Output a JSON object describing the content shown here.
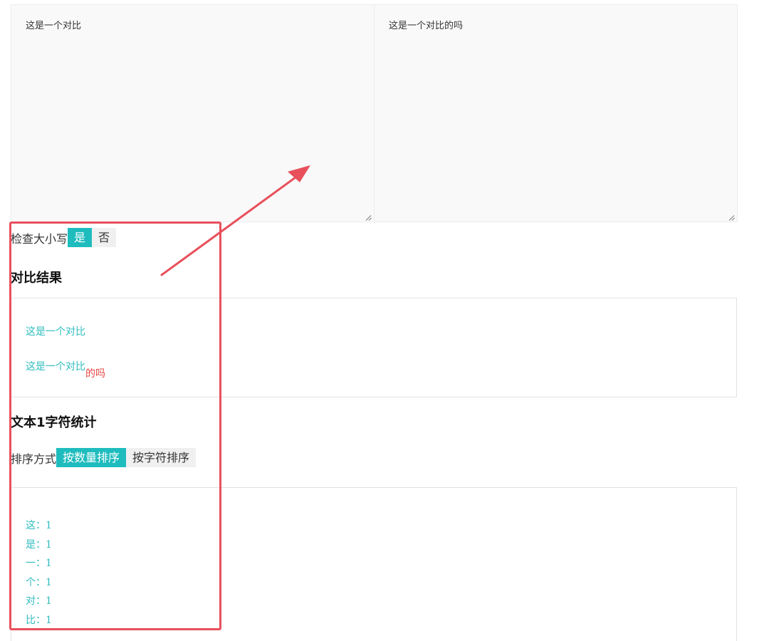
{
  "inputs": {
    "text1": "这是一个对比",
    "text2": "这是一个对比的吗"
  },
  "case_check": {
    "label": "检查大小写",
    "yes": "是",
    "no": "否",
    "selected": "是"
  },
  "result": {
    "heading": "对比结果",
    "line1": "这是一个对比",
    "line2_same": "这是一个对比",
    "line2_added": "的吗"
  },
  "stats": {
    "heading": "文本1字符统计",
    "sort_label": "排序方式",
    "sort_by_count": "按数量排序",
    "sort_by_char": "按字符排序",
    "selected": "按数量排序",
    "items": [
      "这：1",
      "是：1",
      "一：1",
      "个：1",
      "对：1",
      "比：1"
    ]
  },
  "colors": {
    "accent": "#1fbcbe",
    "diff_same": "#2fbcbf",
    "diff_added": "#e5473f",
    "annotation": "#e8505b"
  }
}
